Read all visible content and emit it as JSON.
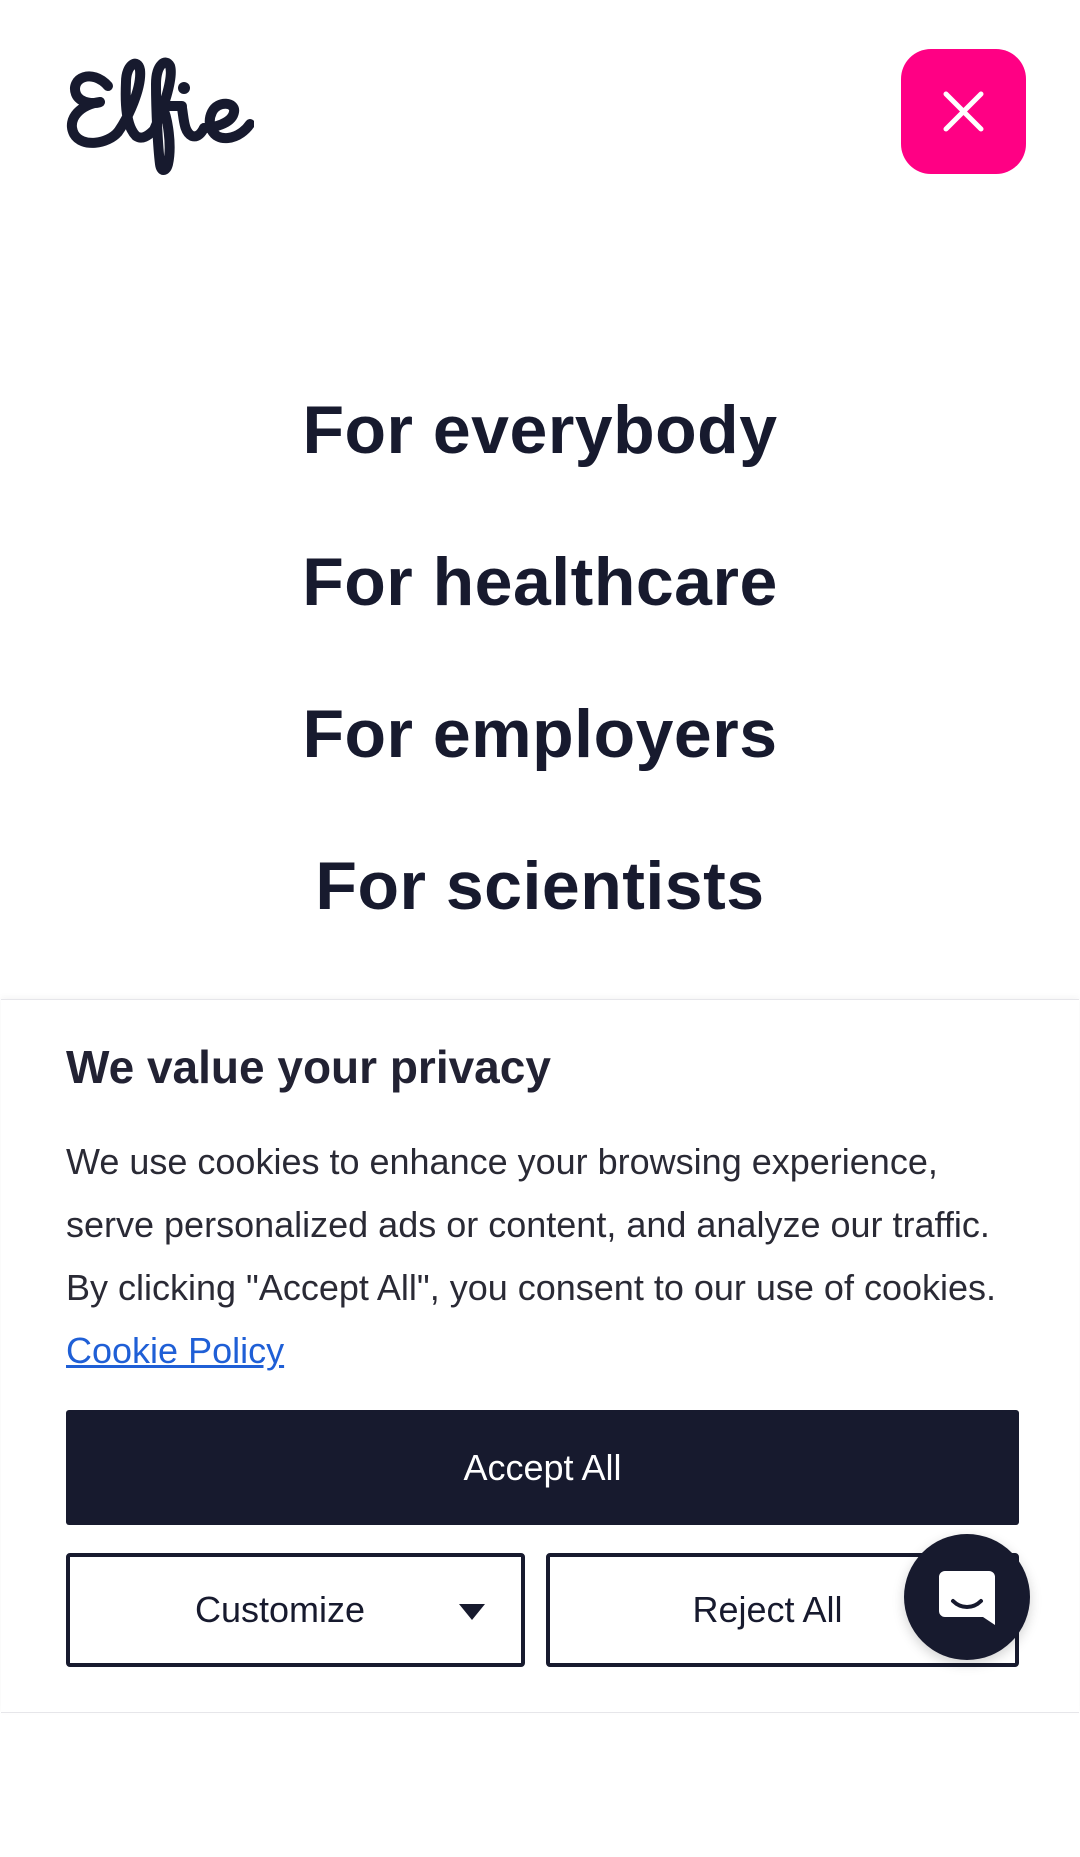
{
  "header": {
    "logo_text": "Elfie",
    "close_icon": "close-icon",
    "accent_color": "#ff0084"
  },
  "nav": {
    "items": [
      {
        "label": "For everybody"
      },
      {
        "label": "For healthcare"
      },
      {
        "label": "For employers"
      },
      {
        "label": "For scientists"
      }
    ]
  },
  "cookie_banner": {
    "title": "We value your privacy",
    "body": "We use cookies to enhance your browsing experience, serve personalized ads or content, and analyze our traffic. By clicking \"Accept All\", you consent to our use of cookies.",
    "policy_link": "Cookie Policy",
    "accept_label": "Accept All",
    "customize_label": "Customize",
    "customize_icon": "caret-down-icon",
    "reject_label": "Reject All",
    "primary_color": "#171a2e",
    "link_color": "#1f5fd6"
  },
  "chat": {
    "icon": "chat-icon"
  }
}
